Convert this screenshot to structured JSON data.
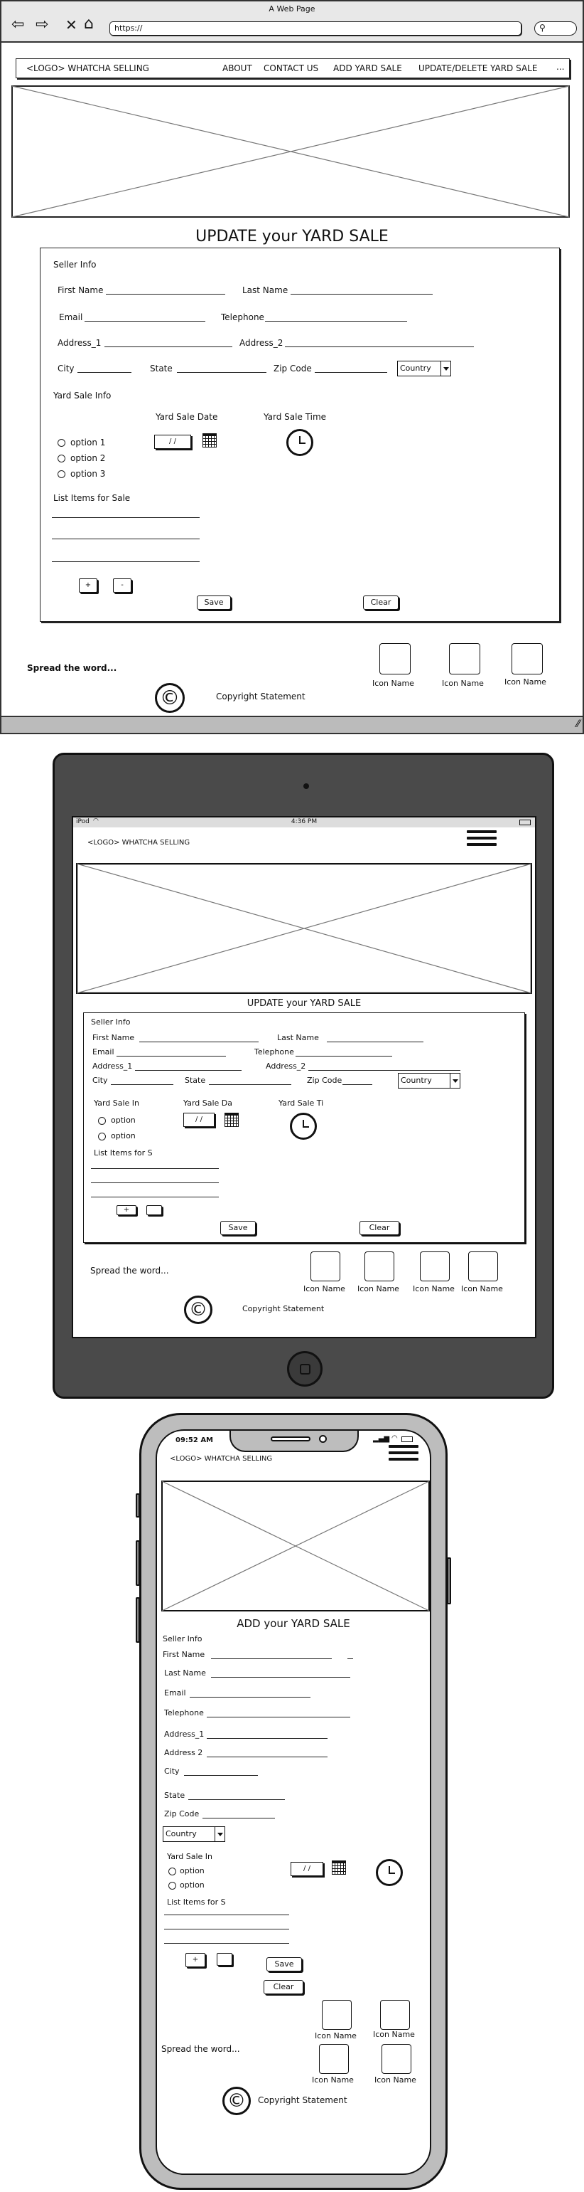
{
  "browser": {
    "title": "A Web Page",
    "url": "https://",
    "nav_icons": [
      "back-icon",
      "forward-icon",
      "close-icon",
      "home-icon",
      "search-icon"
    ]
  },
  "desktop": {
    "nav": {
      "logo": "<LOGO> WHATCHA SELLING",
      "links": [
        "ABOUT",
        "CONTACT US",
        "ADD YARD SALE",
        "UPDATE/DELETE YARD SALE"
      ],
      "more": "..."
    },
    "page_title": "UPDATE your YARD SALE",
    "form": {
      "seller_info": "Seller Info",
      "first_name": "First Name",
      "last_name": "Last Name",
      "email": "Email",
      "telephone": "Telephone",
      "address_1": "Address_1",
      "address_2": "Address_2",
      "city": "City",
      "state": "State",
      "zip_code": "Zip Code",
      "country": "Country",
      "yard_sale_info": "Yard Sale Info",
      "yard_sale_date": "Yard Sale Date",
      "yard_sale_time": "Yard Sale Time",
      "date_value": "/ /",
      "options": [
        "option 1",
        "option 2",
        "option 3"
      ],
      "list_items": "List Items for Sale",
      "plus": "+",
      "minus": "-",
      "save": "Save",
      "clear": "Clear"
    },
    "footer": {
      "spread": "Spread the word...",
      "icon_labels": [
        "Icon Name",
        "Icon Name",
        "Icon Name"
      ],
      "copyright_symbol": "©",
      "copyright": "Copyright Statement"
    }
  },
  "tablet": {
    "status": {
      "carrier": "iPod",
      "time": "4:36 PM"
    },
    "logo": "<LOGO> WHATCHA SELLING",
    "page_title": "UPDATE your YARD SALE",
    "form": {
      "seller_info": "Seller Info",
      "first_name": "First Name",
      "last_name": "Last Name",
      "email": "Email",
      "telephone": "Telephone",
      "address_1": "Address_1",
      "address_2": "Address_2",
      "city": "City",
      "state": "State",
      "zip_code": "Zip Code",
      "country": "Country",
      "yard_sale_in": "Yard Sale In",
      "yard_sale_da": "Yard Sale Da",
      "yard_sale_ti": "Yard Sale Ti",
      "date_value": "/ /",
      "options": [
        "option",
        "option"
      ],
      "list_items": "List Items for S",
      "plus": "+",
      "save": "Save",
      "clear": "Clear"
    },
    "footer": {
      "spread": "Spread the word...",
      "icon_labels": [
        "Icon Name",
        "Icon Name",
        "Icon Name",
        "Icon Name"
      ],
      "copyright_symbol": "©",
      "copyright": "Copyright Statement"
    }
  },
  "phone": {
    "status": {
      "time": "09:52 AM"
    },
    "logo": "<LOGO> WHATCHA SELLING",
    "page_title": "ADD your YARD SALE",
    "form": {
      "seller_info": "Seller Info",
      "first_name": "First Name",
      "last_name": "Last Name",
      "email": "Email",
      "telephone": "Telephone",
      "address_1": "Address_1",
      "address_2": "Address 2",
      "city": "City",
      "state": "State",
      "zip_code": "Zip Code",
      "country": "Country",
      "yard_sale_in": "Yard Sale In",
      "date_value": "/ /",
      "options": [
        "option",
        "option"
      ],
      "list_items": "List Items for S",
      "plus": "+",
      "save": "Save",
      "clear": "Clear"
    },
    "footer": {
      "spread": "Spread the word...",
      "icon_labels": [
        "Icon Name",
        "Icon Name",
        "Icon Name",
        "Icon Name"
      ],
      "copyright_symbol": "©",
      "copyright": "Copyright Statement"
    }
  }
}
